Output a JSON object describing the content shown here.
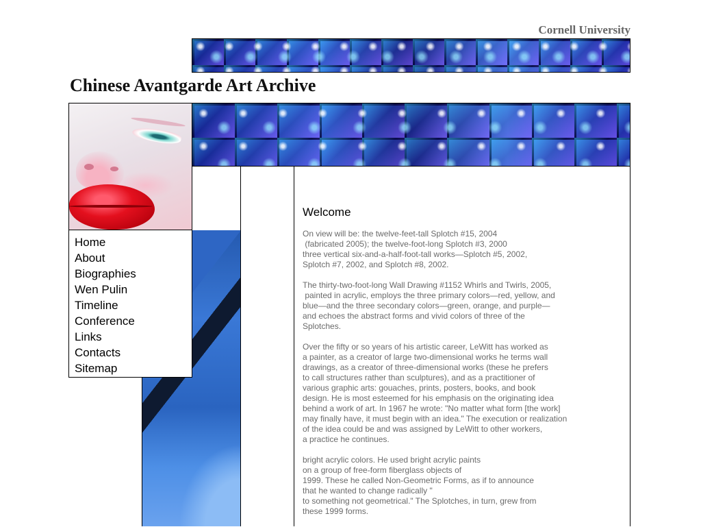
{
  "header": {
    "institution": "Cornell University",
    "site_title": "Chinese Avantgarde Art Archive"
  },
  "nav": {
    "items": [
      {
        "label": "Home"
      },
      {
        "label": "About"
      },
      {
        "label": "Biographies"
      },
      {
        "label": "Wen Pulin"
      },
      {
        "label": "Timeline"
      },
      {
        "label": "Conference"
      },
      {
        "label": "Links"
      },
      {
        "label": "Contacts"
      },
      {
        "label": "Sitemap"
      }
    ]
  },
  "main": {
    "heading": "Welcome",
    "paragraphs": [
      "On view will be: the twelve-feet-tall Splotch #15, 2004\n (fabricated 2005); the twelve-foot-long Splotch #3, 2000\nthree vertical six-and-a-half-foot-tall works—Splotch #5, 2002,\nSplotch #7, 2002, and Splotch #8, 2002.",
      "The thirty-two-foot-long Wall Drawing #1152 Whirls and Twirls, 2005,\n painted in acrylic, employs the three primary colors—red, yellow, and\nblue—and the three secondary colors—green, orange, and purple—\nand echoes the abstract forms and vivid colors of three of the\nSplotches.",
      "Over the fifty or so years of his artistic career, LeWitt has worked as\na painter, as a creator of large two-dimensional works he terms wall\ndrawings, as a creator of three-dimensional works (these he prefers\nto call structures rather than sculptures), and as a practitioner of\nvarious graphic arts: gouaches, prints, posters, books, and book\ndesign. He is most esteemed for his emphasis on the originating idea\nbehind a work of art. In 1967 he wrote: \"No matter what form [the work]\nmay finally have, it must begin with an idea.\" The execution or realization\nof the idea could be and was assigned by LeWitt to other workers,\na practice he continues.",
      "bright acrylic colors. He used bright acrylic paints\non a group of free-form fiberglass objects of\n1999. These he called Non-Geometric Forms, as if to announce\nthat he wanted to change radically \"\nto something not geometrical.\" The Splotches, in turn, grew from\nthese 1999 forms."
    ]
  },
  "colors": {
    "background": "#ffffff",
    "body_text": "#6a6a6a",
    "institution_text": "#666666",
    "banner_blue": "#1d2fb8"
  },
  "images": {
    "banner_top": "glass-tiles-banner",
    "banner_main": "glass-tiles-banner",
    "face": "painted-face-red-lips",
    "column": "blue-diagonal-abstract"
  }
}
